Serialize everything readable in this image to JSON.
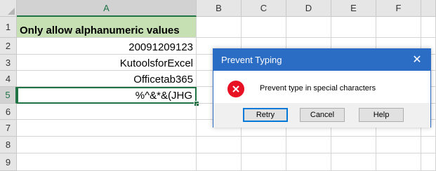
{
  "columns": [
    "A",
    "B",
    "C",
    "D",
    "E",
    "F"
  ],
  "rows": [
    "1",
    "2",
    "3",
    "4",
    "5",
    "6",
    "7",
    "8",
    "9"
  ],
  "cells": {
    "a1": "Only allow alphanumeric values",
    "a2": "20091209123",
    "a3": "KutoolsforExcel",
    "a4": "Officetab365",
    "a5": "%^&*&(JHG"
  },
  "header_fill": "#c6e0b4",
  "dialog": {
    "title": "Prevent Typing",
    "message": "Prevent type in special characters",
    "icon": "error-icon",
    "buttons": {
      "retry": "Retry",
      "cancel": "Cancel",
      "help": "Help"
    },
    "close_glyph": "✕",
    "accent": "#2b6cc4"
  }
}
